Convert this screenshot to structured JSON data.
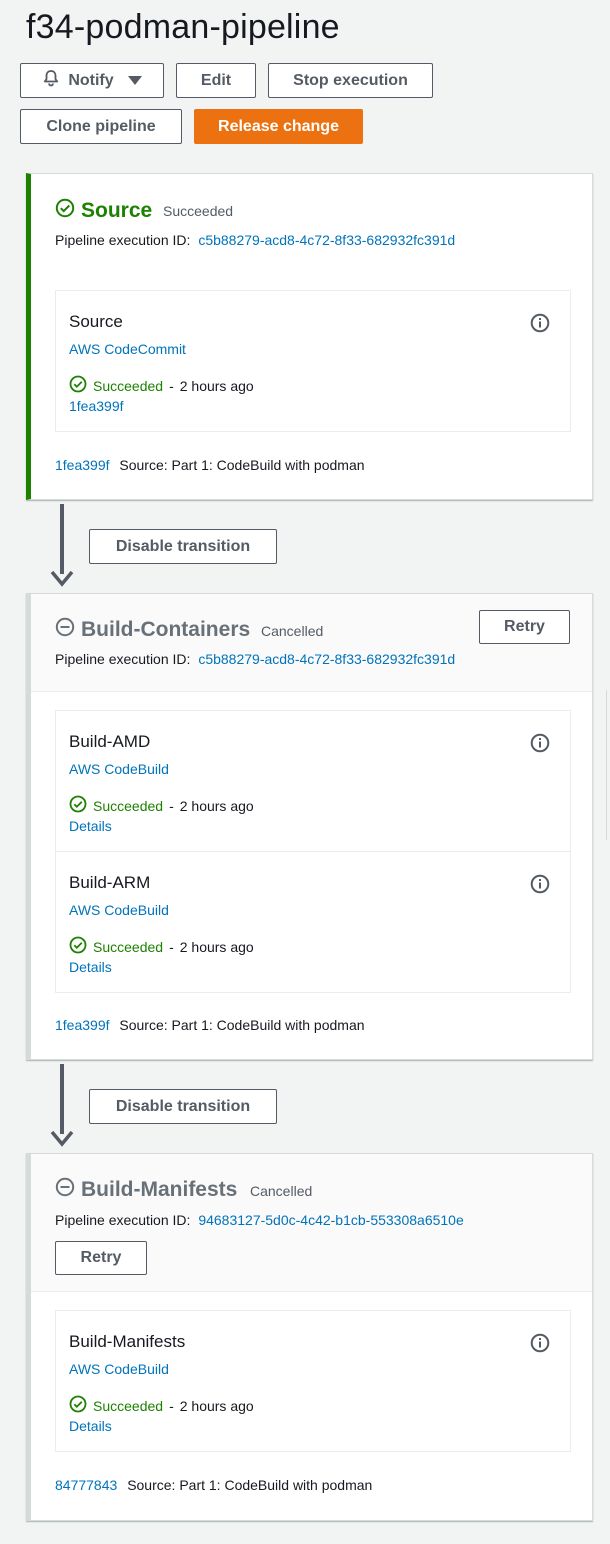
{
  "page": {
    "title": "f34-podman-pipeline"
  },
  "toolbar": {
    "notify": "Notify",
    "edit": "Edit",
    "stop": "Stop execution",
    "clone": "Clone pipeline",
    "release": "Release change"
  },
  "exec_label": "Pipeline execution ID:",
  "transition_label": "Disable transition",
  "colors": {
    "success": "#1d8102",
    "primary": "#ec7211",
    "link": "#0073bb",
    "cancelled": "#687078"
  },
  "stages": [
    {
      "name": "Source",
      "status": "Succeeded",
      "execution_id": "c5b88279-acd8-4c72-8f33-682932fc391d",
      "actions": [
        {
          "name": "Source",
          "provider": "AWS CodeCommit",
          "status": "Succeeded",
          "time": "2 hours ago",
          "link": "1fea399f"
        }
      ],
      "commit": {
        "id": "1fea399f",
        "message": "Source: Part 1: CodeBuild with podman"
      }
    },
    {
      "name": "Build-Containers",
      "status": "Cancelled",
      "retry": "Retry",
      "execution_id": "c5b88279-acd8-4c72-8f33-682932fc391d",
      "actions": [
        {
          "name": "Build-AMD",
          "provider": "AWS CodeBuild",
          "status": "Succeeded",
          "time": "2 hours ago",
          "link": "Details"
        },
        {
          "name": "Build-ARM",
          "provider": "AWS CodeBuild",
          "status": "Succeeded",
          "time": "2 hours ago",
          "link": "Details"
        }
      ],
      "commit": {
        "id": "1fea399f",
        "message": "Source: Part 1: CodeBuild with podman"
      }
    },
    {
      "name": "Build-Manifests",
      "status": "Cancelled",
      "retry": "Retry",
      "execution_id": "94683127-5d0c-4c42-b1cb-553308a6510e",
      "actions": [
        {
          "name": "Build-Manifests",
          "provider": "AWS CodeBuild",
          "status": "Succeeded",
          "time": "2 hours ago",
          "link": "Details"
        }
      ],
      "commit": {
        "id": "84777843",
        "message": "Source: Part 1: CodeBuild with podman"
      }
    }
  ]
}
